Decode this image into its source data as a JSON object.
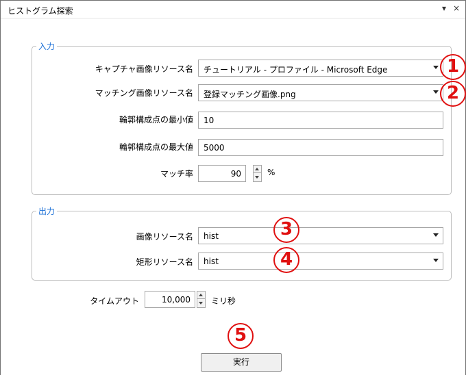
{
  "window": {
    "title": "ヒストグラム探索",
    "pin_symbol": "▾",
    "close_symbol": "×"
  },
  "input_group": {
    "label": "入力",
    "capture_resource": {
      "label": "キャプチャ画像リソース名",
      "value": "チュートリアル - プロファイル - Microsoft Edge"
    },
    "matching_resource": {
      "label": "マッチング画像リソース名",
      "value": "登録マッチング画像.png"
    },
    "contour_min": {
      "label": "輪郭構成点の最小値",
      "value": "10"
    },
    "contour_max": {
      "label": "輪郭構成点の最大値",
      "value": "5000"
    },
    "match_rate": {
      "label": "マッチ率",
      "value": "90",
      "unit": "%"
    }
  },
  "output_group": {
    "label": "出力",
    "image_resource": {
      "label": "画像リソース名",
      "value": "hist"
    },
    "rect_resource": {
      "label": "矩形リソース名",
      "value": "hist"
    }
  },
  "timeout": {
    "label": "タイムアウト",
    "value": "10,000",
    "unit": "ミリ秒"
  },
  "run_button": {
    "label": "実行"
  },
  "markers": [
    "1",
    "2",
    "3",
    "4",
    "5"
  ],
  "colors": {
    "marker": "#e01010",
    "group_label": "#1a6fd6"
  }
}
